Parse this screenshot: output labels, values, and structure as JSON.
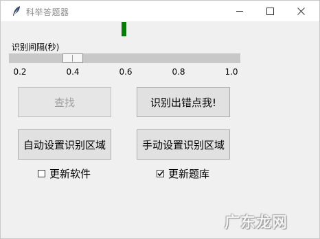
{
  "window": {
    "title": "科举答题器"
  },
  "scale": {
    "label": "识别间隔(秒)",
    "value": 0.4,
    "min": 0.2,
    "max": 1.0,
    "ticks": [
      "0.2",
      "0.4",
      "0.6",
      "0.8",
      "1.0"
    ]
  },
  "buttons": {
    "search": "查找",
    "mark_wrong": "识别出错点我!",
    "auto_region": "自动设置识别区域",
    "manual_region": "手动设置识别区域"
  },
  "checkboxes": {
    "update_software": {
      "label": "更新软件",
      "checked": false
    },
    "update_bank": {
      "label": "更新题库",
      "checked": true
    }
  },
  "watermark": "广东龙网",
  "colors": {
    "indicator": "#008000",
    "trough": "#c8c8c8",
    "button": "#e1e1e1"
  },
  "icons": {
    "app": "feather-icon",
    "minimize": "minimize-icon",
    "maximize": "maximize-icon",
    "close": "close-icon",
    "checkmark": "checkmark-icon"
  }
}
